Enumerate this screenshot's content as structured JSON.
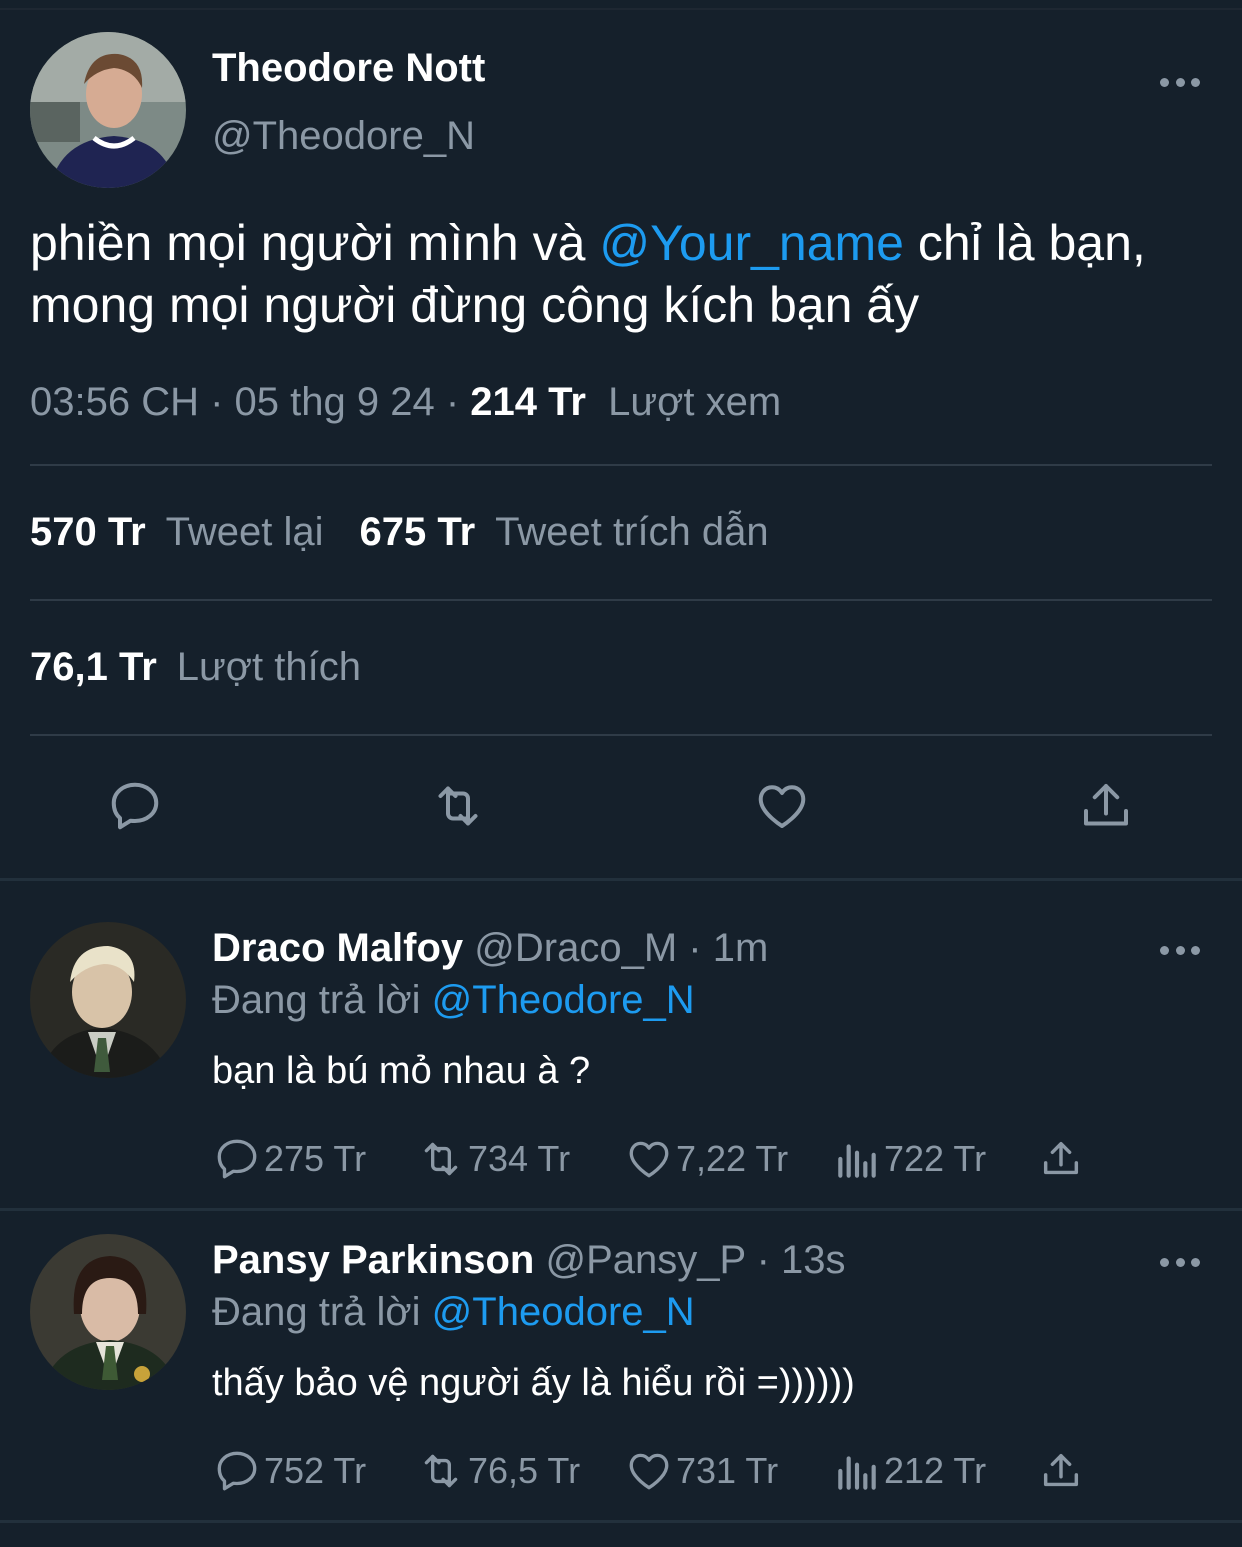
{
  "main_tweet": {
    "display_name": "Theodore Nott",
    "handle": "@Theodore_N",
    "text_before": "phiền mọi người mình và ",
    "mention": "@Your_name",
    "text_after": " chỉ là bạn, mong mọi người đừng công kích bạn ấy",
    "time": "03:56 CH",
    "date": "05 thg 9 24",
    "views_count": "214 Tr",
    "views_label": "Lượt xem",
    "retweets_count": "570 Tr",
    "retweets_label": "Tweet lại",
    "quotes_count": "675 Tr",
    "quotes_label": "Tweet trích dẫn",
    "likes_count": "76,1 Tr",
    "likes_label": "Lượt thích"
  },
  "replies": [
    {
      "display_name": "Draco Malfoy",
      "handle": "@Draco_M",
      "time": "1m",
      "replying_label": "Đang trả lời",
      "replying_to": "@Theodore_N",
      "text": "bạn là bú mỏ nhau à ?",
      "replies": "275 Tr",
      "retweets": "734 Tr",
      "likes": "7,22 Tr",
      "views": "722 Tr"
    },
    {
      "display_name": "Pansy Parkinson",
      "handle": "@Pansy_P",
      "time": "13s",
      "replying_label": "Đang trả lời",
      "replying_to": "@Theodore_N",
      "text": "thấy bảo vệ người ấy là hiểu rồi =))))))",
      "replies": "752 Tr",
      "retweets": "76,5 Tr",
      "likes": "731 Tr",
      "views": "212 Tr"
    }
  ],
  "colors": {
    "background": "#15202b",
    "accent": "#1d9bf0",
    "secondary_text": "#8b98a5"
  }
}
